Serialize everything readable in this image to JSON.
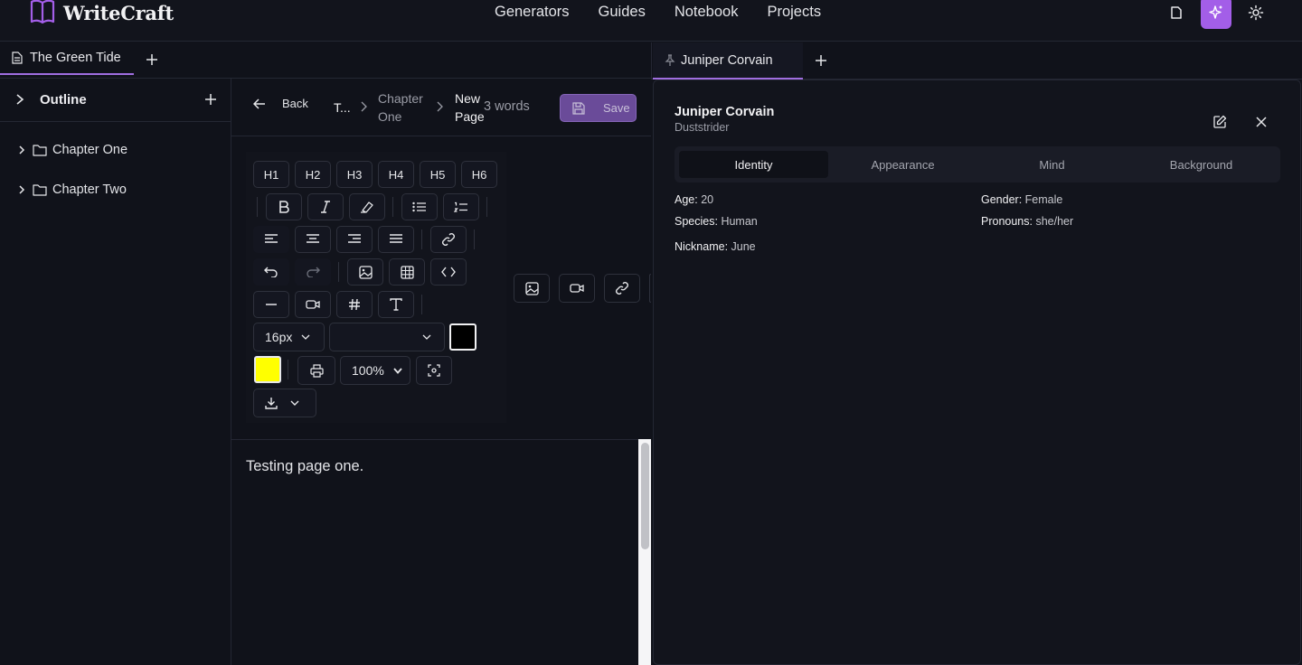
{
  "app": {
    "name": "WriteCraft"
  },
  "nav": {
    "links": [
      "Generators",
      "Guides",
      "Notebook",
      "Projects"
    ]
  },
  "colors": {
    "accent": "#a35ee8",
    "text_color_swatch": "#000000",
    "highlight_swatch": "#ffff00"
  },
  "doc_tab": {
    "label": "The Green Tide"
  },
  "sidebar": {
    "title": "Outline",
    "items": [
      {
        "label": "Chapter One"
      },
      {
        "label": "Chapter Two"
      }
    ]
  },
  "editor": {
    "back_label": "Back",
    "breadcrumb": [
      "T...",
      "Chapter\nOne",
      "New\nPage"
    ],
    "crumb_root": "T...",
    "crumb_chapter_1": "Chapter",
    "crumb_chapter_2": "One",
    "crumb_page_1": "New",
    "crumb_page_2": "Page",
    "word_count": "3 words",
    "save_label": "Save",
    "content": "Testing page one."
  },
  "toolbar": {
    "headings": [
      "H1",
      "H2",
      "H3",
      "H4",
      "H5",
      "H6"
    ],
    "font_size": "16px",
    "font_family": "",
    "zoom": "100%"
  },
  "character_tab": {
    "label": "Juniper Corvain"
  },
  "character": {
    "name": "Juniper Corvain",
    "subtitle": "Duststrider",
    "tabs": [
      "Identity",
      "Appearance",
      "Mind",
      "Background"
    ],
    "active_tab": "Identity",
    "fields": {
      "age_label": "Age:",
      "age": "20",
      "gender_label": "Gender:",
      "gender": "Female",
      "species_label": "Species:",
      "species": "Human",
      "pronouns_label": "Pronouns:",
      "pronouns": "she/her",
      "nickname_label": "Nickname:",
      "nickname": "June"
    }
  }
}
